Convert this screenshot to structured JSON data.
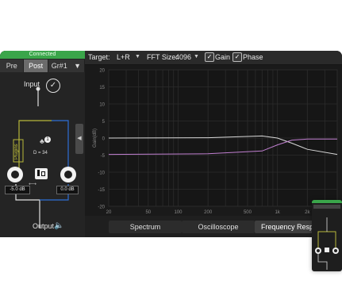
{
  "status": "Connected",
  "tabs": {
    "pre": "Pre",
    "post": "Post",
    "group": "Gr#1"
  },
  "routing": {
    "input_label": "Input",
    "output_label": "Output",
    "plugins_label": "Plugins",
    "badge_count": "1",
    "delay_label": "D = 34",
    "left_level": "-5.0 dB",
    "right_level": "0.0 dB"
  },
  "toolbar": {
    "target_label": "Target:",
    "target_value": "L+R",
    "fft_label": "FFT Size:",
    "fft_value": "4096",
    "gain_label": "Gain",
    "phase_label": "Phase"
  },
  "chart_data": {
    "type": "line",
    "ylabel": "Gain(dB)",
    "y_ticks": [
      20,
      15,
      10,
      5,
      0,
      -5,
      -10,
      -15,
      -20
    ],
    "x_ticks": [
      "20",
      "50",
      "100",
      "200",
      "500",
      "1k",
      "2k"
    ],
    "xscale": "log",
    "xlim": [
      20,
      4000
    ],
    "ylim": [
      -20,
      20
    ],
    "grid": true,
    "series": [
      {
        "color": "#d8d8d8",
        "x": [
          20,
          200,
          700,
          1000,
          1400,
          2000,
          4000
        ],
        "values": [
          0.0,
          0.1,
          0.6,
          0.0,
          -1.5,
          -3.3,
          -4.8
        ]
      },
      {
        "color": "#c07fd0",
        "x": [
          20,
          200,
          700,
          1000,
          1400,
          2000,
          4000
        ],
        "values": [
          -4.8,
          -4.6,
          -3.8,
          -2.0,
          -0.6,
          -0.3,
          -0.3
        ]
      }
    ]
  },
  "views": {
    "spectrum": "Spectrum",
    "oscilloscope": "Oscilloscope",
    "frequency": "Frequency Respon"
  }
}
